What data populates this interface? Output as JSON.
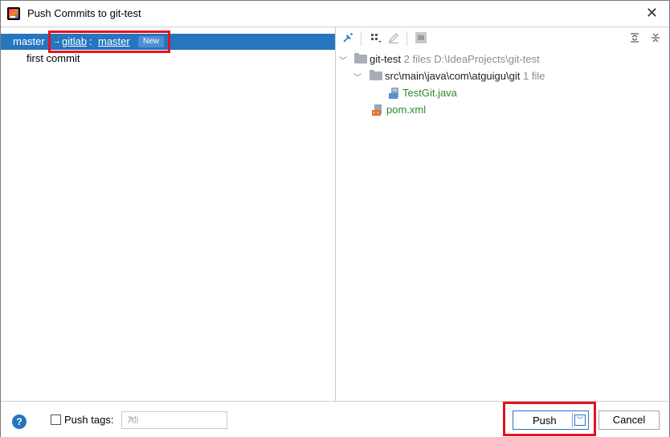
{
  "window": {
    "title": "Push Commits to git-test",
    "close_glyph": "✕"
  },
  "left": {
    "branch": {
      "local": "master",
      "arrow": "→",
      "remote": "gitlab",
      "separator": ":",
      "target": "master",
      "badge": "New"
    },
    "commits": [
      "first commit"
    ]
  },
  "right": {
    "toolbar_icons": [
      "pin-icon",
      "group-by-icon",
      "edit-icon",
      "preview-icon",
      "expand-all-icon",
      "collapse-all-icon"
    ],
    "tree": {
      "root": {
        "name": "git-test",
        "count": "2 files",
        "path": "D:\\IdeaProjects\\git-test"
      },
      "folder": {
        "name": "src\\main\\java\\com\\atguigu\\git",
        "count": "1 file"
      },
      "files": [
        {
          "name": "TestGit.java",
          "icon": "java-file-icon"
        },
        {
          "name": "pom.xml",
          "icon": "xml-file-icon"
        }
      ]
    }
  },
  "bottom": {
    "push_tags_label": "Push tags:",
    "tags_value": "All",
    "push_label": "Push",
    "cancel_label": "Cancel",
    "help_glyph": "?"
  },
  "colors": {
    "selection": "#2675bf",
    "highlight": "#e5121f",
    "file_added": "#2c8a2c"
  }
}
